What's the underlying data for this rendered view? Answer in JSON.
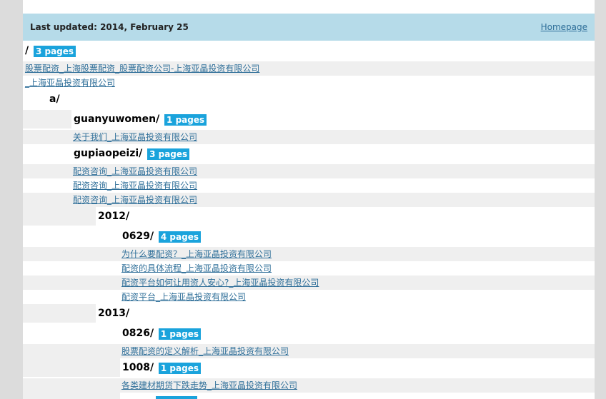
{
  "header": {
    "updated": "Last updated: 2014, February 25",
    "homepage": "Homepage"
  },
  "root": {
    "name": "/",
    "badge": "3 pages",
    "links": [
      "股票配资_上海股票配资_股票配资公司-上海亚晶投资有限公司",
      "_上海亚晶投资有限公司"
    ]
  },
  "dir_a": {
    "name": "a/"
  },
  "guanyuwomen": {
    "name": "guanyuwomen/",
    "badge": "1 pages",
    "links": [
      "关于我们_上海亚晶投资有限公司"
    ]
  },
  "gupiaopeizi": {
    "name": "gupiaopeizi/",
    "badge": "3 pages",
    "links": [
      "配资咨询_上海亚晶投资有限公司",
      "配资咨询_上海亚晶投资有限公司",
      "配资咨询_上海亚晶投资有限公司"
    ]
  },
  "y2012": {
    "name": "2012/"
  },
  "d0629": {
    "name": "0629/",
    "badge": "4 pages",
    "links": [
      "为什么要配资？_上海亚晶投资有限公司",
      "配资的具体流程_上海亚晶投资有限公司",
      "配资平台如何让用资人安心?_上海亚晶投资有限公司",
      "配资平台_上海亚晶投资有限公司"
    ]
  },
  "y2013": {
    "name": "2013/"
  },
  "d0826": {
    "name": "0826/",
    "badge": "1 pages",
    "links": [
      "股票配资的定义解析_上海亚晶投资有限公司"
    ]
  },
  "d1008": {
    "name": "1008/",
    "badge": "1 pages",
    "links": [
      "各类建材期货下跌走势_上海亚晶投资有限公司"
    ]
  },
  "colors": {
    "header_bg": "#b6dbe9",
    "badge_bg": "#1aa3dc",
    "link": "#2f6f99",
    "shade": "#efefef"
  }
}
